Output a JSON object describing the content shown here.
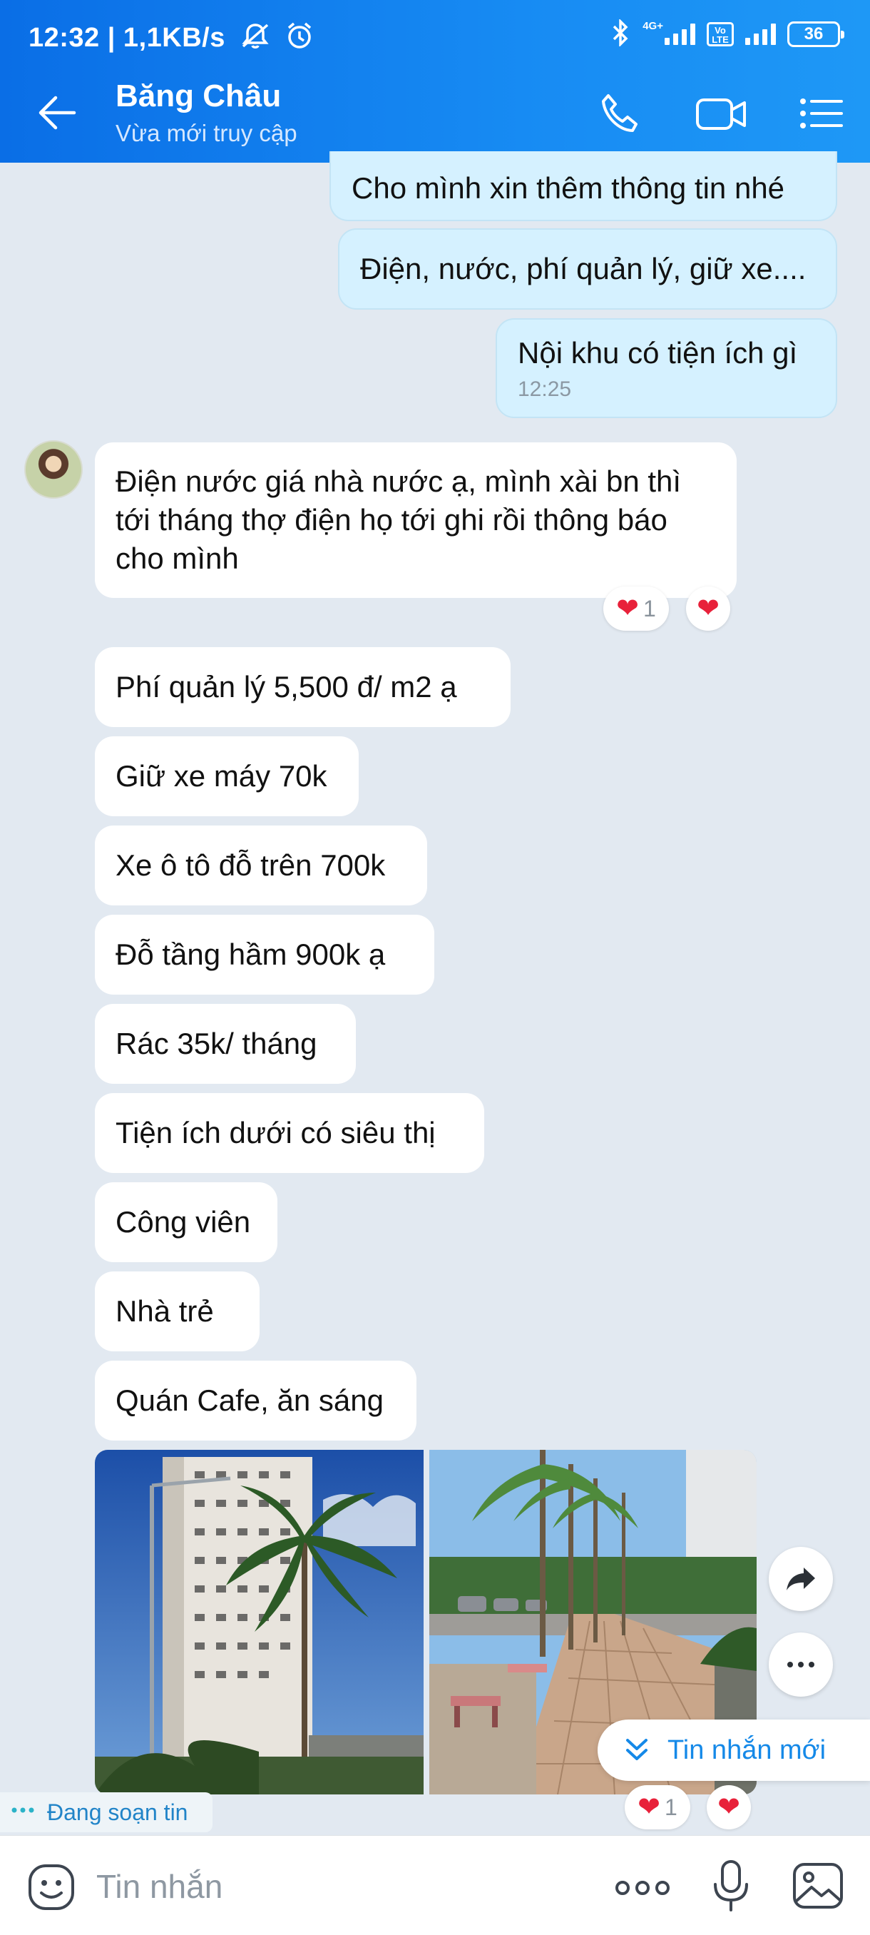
{
  "status_bar": {
    "time_speed": "12:32 | 1,1KB/s",
    "network_label": "4G+",
    "volte_label": "Vo\nLTE",
    "battery": "36"
  },
  "header": {
    "contact_name": "Băng Châu",
    "presence": "Vừa mới truy cập"
  },
  "messages": {
    "out1": "Cho mình xin thêm thông tin nhé",
    "out2": "Điện, nước, phí quản lý, giữ xe....",
    "out3": "Nội khu có tiện ích gì",
    "out3_time": "12:25",
    "in1_line1": "Điện nước giá nhà nước ạ,  mình xài bn thì",
    "in1_line2": "tới tháng thợ điện họ tới ghi rồi thông báo",
    "in1_line3": "cho mình",
    "in2": "Phí quản lý 5,500 đ/ m2 ạ",
    "in3": "Giữ xe máy 70k",
    "in4": "Xe ô tô đỗ trên 700k",
    "in5": "Đỗ tầng hầm 900k ạ",
    "in6": "Rác 35k/ tháng",
    "in7": "Tiện ích dưới có siêu thị",
    "in8": "Công viên",
    "in9": "Nhà trẻ",
    "in10": "Quán Cafe, ăn sáng"
  },
  "reactions": {
    "in1_count": "1",
    "photos_count": "1"
  },
  "new_message_banner": "Tin nhắn mới",
  "typing_indicator": "Đang soạn tin",
  "composer": {
    "placeholder": "Tin nhắn"
  }
}
